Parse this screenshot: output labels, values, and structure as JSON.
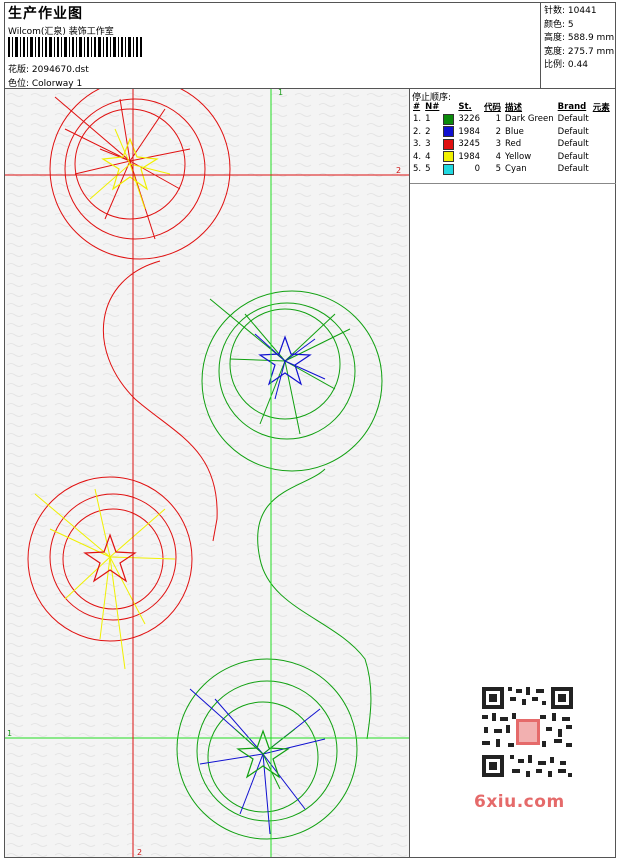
{
  "header": {
    "title": "生产作业图",
    "company": "Wilcom(汇泉) 装饰工作室",
    "design_label": "花版: 2094670.dst",
    "colorway_label": "色位: Colorway 1"
  },
  "stats": [
    {
      "label": "针数",
      "value": "10441"
    },
    {
      "label": "颜色",
      "value": "5"
    },
    {
      "label": "高度",
      "value": "588.9 mm"
    },
    {
      "label": "宽度",
      "value": "275.7 mm"
    },
    {
      "label": "比例",
      "value": "0.44"
    }
  ],
  "panel": {
    "title": "停止顺序:",
    "columns": [
      "#",
      "N#",
      "St.",
      "代码",
      "描述",
      "Brand",
      "元素"
    ],
    "rows": [
      {
        "num": "1.",
        "n": "1",
        "color": "#0a8a0a",
        "st": "3226",
        "code": "1",
        "desc": "Dark Green",
        "brand": "Default"
      },
      {
        "num": "2.",
        "n": "2",
        "color": "#1010d0",
        "st": "1984",
        "code": "2",
        "desc": "Blue",
        "brand": "Default"
      },
      {
        "num": "3.",
        "n": "3",
        "color": "#e01010",
        "st": "3245",
        "code": "3",
        "desc": "Red",
        "brand": "Default"
      },
      {
        "num": "4.",
        "n": "4",
        "color": "#f0f000",
        "st": "1984",
        "code": "4",
        "desc": "Yellow",
        "brand": "Default"
      },
      {
        "num": "5.",
        "n": "5",
        "color": "#20d8e0",
        "st": "0",
        "code": "5",
        "desc": "Cyan",
        "brand": "Default"
      }
    ]
  },
  "guides": {
    "green_top_label": "1",
    "green_left_label": "1",
    "red_right_label": "2",
    "red_bottom_label": "2"
  },
  "colors": {
    "red": "#e01010",
    "green": "#10a010",
    "blue": "#1010d0",
    "yellow": "#f0f000",
    "guide_green": "#22dd22",
    "guide_red": "#dd1111"
  },
  "watermark": {
    "text": "6xiu.com"
  }
}
